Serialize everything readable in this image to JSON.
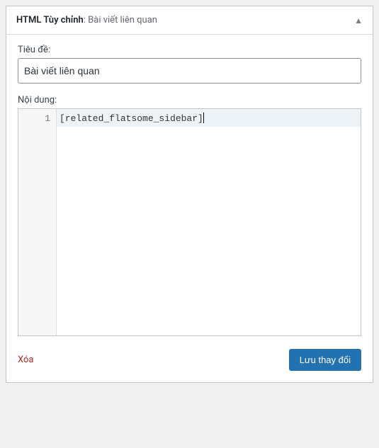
{
  "widget": {
    "title": "HTML Tùy chỉnh",
    "subtitle": "Bài viết liên quan"
  },
  "form": {
    "title_label": "Tiêu đề:",
    "title_value": "Bài viết liên quan",
    "content_label": "Nội dung:"
  },
  "editor": {
    "line_number": "1",
    "line_content": "[related_flatsome_sidebar]"
  },
  "footer": {
    "delete_label": "Xóa",
    "save_label": "Lưu thay đổi"
  }
}
